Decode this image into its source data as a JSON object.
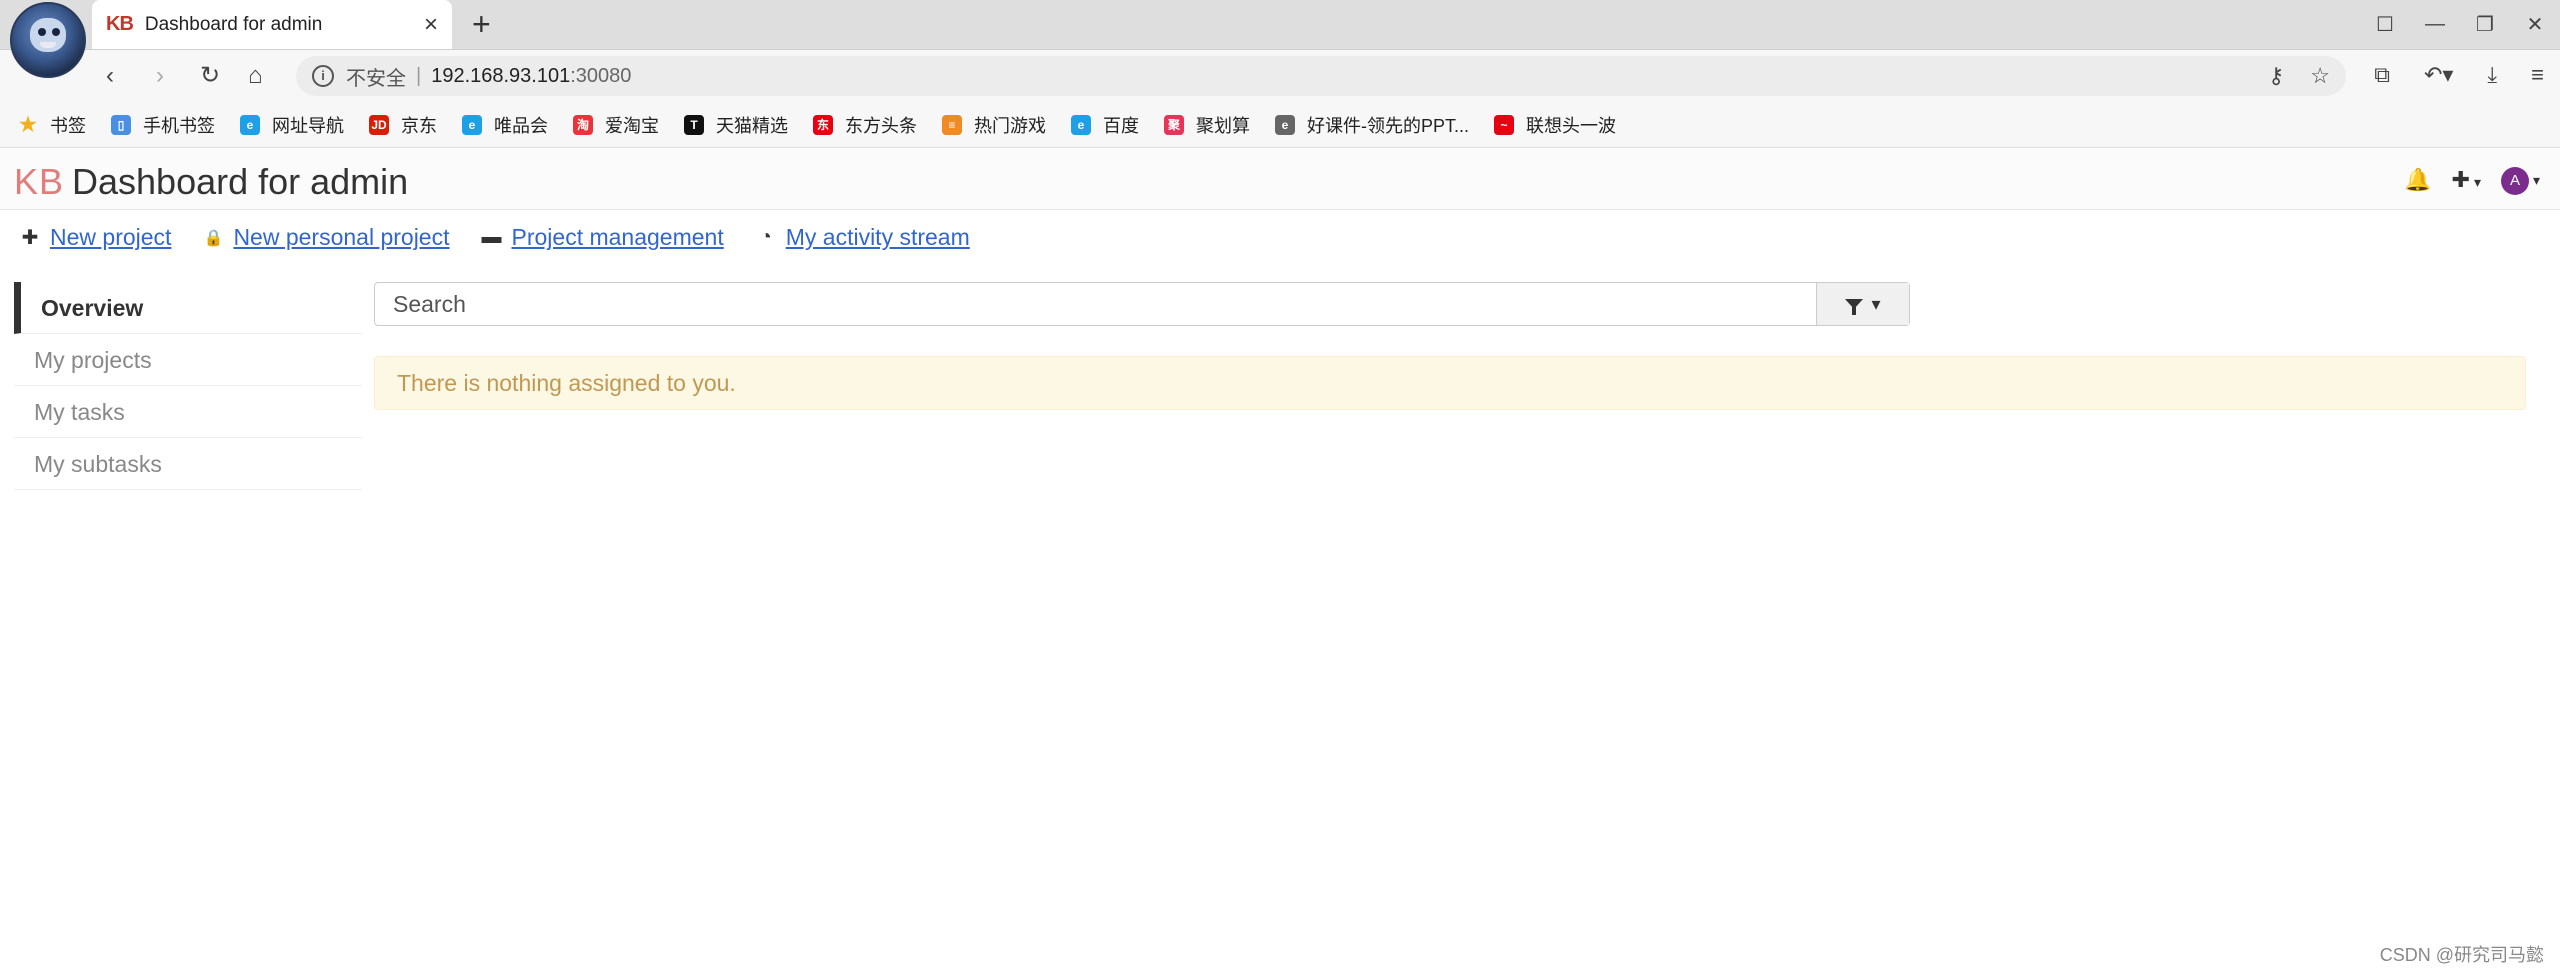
{
  "browser": {
    "tab": {
      "favicon": "KB",
      "title": "Dashboard for admin"
    },
    "new_tab": "+",
    "window_controls": [
      "☐",
      "—",
      "❐",
      "✕"
    ],
    "nav": {
      "back": "‹",
      "forward": "›",
      "reload": "↻",
      "home": "⌂"
    },
    "address": {
      "info": "i",
      "insecure": "不安全",
      "separator": "|",
      "host": "192.168.93.101",
      "port": ":30080"
    },
    "omni_icons": {
      "key": "⚷",
      "star": "☆"
    },
    "toolbar_icons": {
      "extensions": "⧉",
      "undo": "↶▾",
      "download": "⤓",
      "menu": "≡"
    },
    "bookmarks": [
      {
        "label": "书签",
        "icon": "star-icon",
        "color": "#f2b01e",
        "glyph": "★"
      },
      {
        "label": "手机书签",
        "icon": "phone-icon",
        "color": "#4a90e2",
        "glyph": "▯"
      },
      {
        "label": "网址导航",
        "icon": "e-icon",
        "color": "#1ea0e8",
        "glyph": "e"
      },
      {
        "label": "京东",
        "icon": "jd-icon",
        "color": "#d81e06",
        "glyph": "JD"
      },
      {
        "label": "唯品会",
        "icon": "e-icon",
        "color": "#1ea0e8",
        "glyph": "e"
      },
      {
        "label": "爱淘宝",
        "icon": "taobao-icon",
        "color": "#e8353b",
        "glyph": "淘"
      },
      {
        "label": "天猫精选",
        "icon": "tmall-icon",
        "color": "#111111",
        "glyph": "T"
      },
      {
        "label": "东方头条",
        "icon": "dftt-icon",
        "color": "#e60012",
        "glyph": "东"
      },
      {
        "label": "热门游戏",
        "icon": "game-icon",
        "color": "#f08a24",
        "glyph": "≡"
      },
      {
        "label": "百度",
        "icon": "e-icon",
        "color": "#1ea0e8",
        "glyph": "e"
      },
      {
        "label": "聚划算",
        "icon": "juhuasuan-icon",
        "color": "#e8335b",
        "glyph": "聚"
      },
      {
        "label": "好课件-领先的PPT...",
        "icon": "e-gray-icon",
        "color": "#666666",
        "glyph": "e"
      },
      {
        "label": "联想头一波",
        "icon": "lenovo-icon",
        "color": "#e60012",
        "glyph": "~"
      }
    ]
  },
  "header": {
    "logo": "KB",
    "title": "Dashboard for admin",
    "icons": {
      "bell": "🔔",
      "plus": "✚",
      "caret": "▾",
      "avatar_initial": "A"
    }
  },
  "actions": [
    {
      "label": "New project",
      "icon": "plus-icon",
      "glyph": "✚"
    },
    {
      "label": "New personal project",
      "icon": "lock-icon",
      "glyph": "🔒"
    },
    {
      "label": "Project management",
      "icon": "folder-icon",
      "glyph": "▬"
    },
    {
      "label": "My activity stream",
      "icon": "dashboard-icon",
      "glyph": "◔"
    }
  ],
  "sidebar": {
    "items": [
      {
        "label": "Overview",
        "active": true
      },
      {
        "label": "My projects"
      },
      {
        "label": "My tasks"
      },
      {
        "label": "My subtasks"
      }
    ]
  },
  "search": {
    "placeholder": "Search",
    "filter_caret": "▾"
  },
  "alert": {
    "message": "There is nothing assigned to you."
  },
  "watermark": "CSDN @研究司马懿"
}
